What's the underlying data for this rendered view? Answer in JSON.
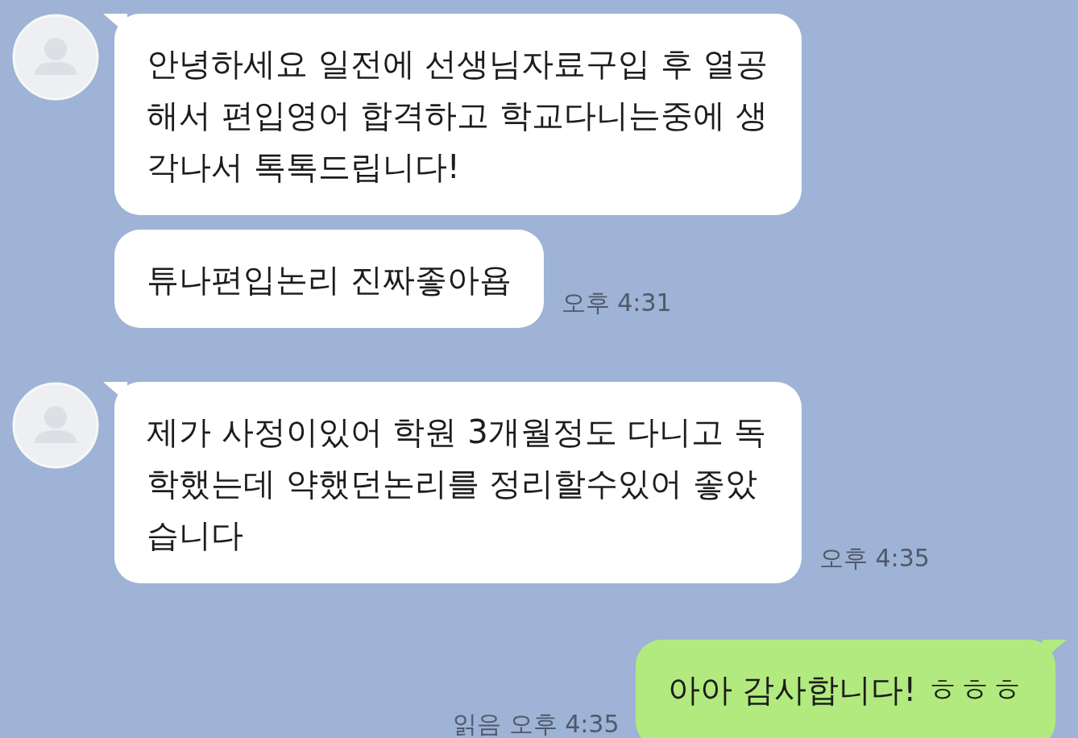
{
  "groups": [
    {
      "kind": "received",
      "messages": [
        {
          "text": "안녕하세요 일전에 선생님자료구입 후 열공해서 편입영어 합격하고 학교다니는중에 생각나서 톡톡드립니다!"
        },
        {
          "text": "튜나편입논리 진짜좋아욥",
          "time": "오후 4:31"
        }
      ]
    },
    {
      "kind": "received",
      "messages": [
        {
          "text": "제가 사정이있어 학원 3개월정도 다니고 독학했는데 약했던논리를 정리할수있어 좋았습니다",
          "time": "오후 4:35"
        }
      ]
    },
    {
      "kind": "sent",
      "messages": [
        {
          "text": "아아 감사합니다! ㅎㅎㅎ",
          "read": "읽음",
          "time": "오후 4:35"
        }
      ]
    }
  ]
}
